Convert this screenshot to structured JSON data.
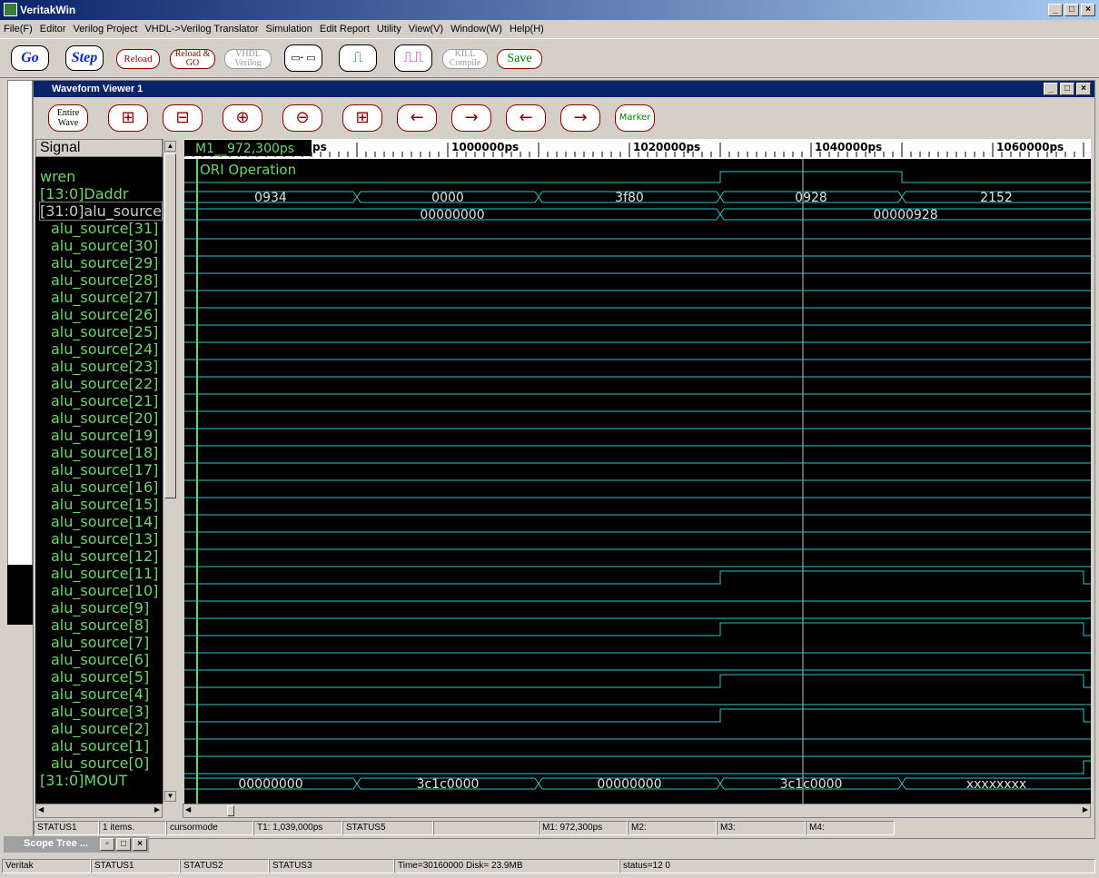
{
  "app": {
    "title": "VeritakWin"
  },
  "menu": [
    "File(F)",
    "Editor",
    "Verilog Project",
    "VHDL->Verilog Translator",
    "Simulation",
    "Edit Report",
    "Utility",
    "View(V)",
    "Window(W)",
    "Help(H)"
  ],
  "toolbar": {
    "go": "Go",
    "step": "Step",
    "reload": "Reload",
    "reload_go": "Reload & GO",
    "vhdl_verilog": "VHDL Verilog",
    "kill_compile": "KILL Compile",
    "save": "Save"
  },
  "viewer": {
    "title": "Waveform Viewer 1",
    "entire_wave": "Entire Wave",
    "marker": "Marker",
    "signal_header": "Signal",
    "marker_label": "M1__972,300ps",
    "ruler": [
      "1000000ps",
      "1020000ps",
      "1040000ps",
      "1060000ps"
    ],
    "annotation": "ORI Operation"
  },
  "signals": [
    "wren",
    "[13:0]Daddr",
    "[31:0]alu_source",
    "alu_source[31]",
    "alu_source[30]",
    "alu_source[29]",
    "alu_source[28]",
    "alu_source[27]",
    "alu_source[26]",
    "alu_source[25]",
    "alu_source[24]",
    "alu_source[23]",
    "alu_source[22]",
    "alu_source[21]",
    "alu_source[20]",
    "alu_source[19]",
    "alu_source[18]",
    "alu_source[17]",
    "alu_source[16]",
    "alu_source[15]",
    "alu_source[14]",
    "alu_source[13]",
    "alu_source[12]",
    "alu_source[11]",
    "alu_source[10]",
    "alu_source[9]",
    "alu_source[8]",
    "alu_source[7]",
    "alu_source[6]",
    "alu_source[5]",
    "alu_source[4]",
    "alu_source[3]",
    "alu_source[2]",
    "alu_source[1]",
    "alu_source[0]",
    "[31:0]MOUT"
  ],
  "bus_values": {
    "daddr": [
      "0934",
      "0000",
      "3f80",
      "0928",
      "2152"
    ],
    "alu_source": [
      "00000000",
      "00000928"
    ],
    "mout": [
      "00000000",
      "3c1c0000",
      "00000000",
      "3c1c0000",
      "xxxxxxxx"
    ]
  },
  "status_bar": {
    "s1": "STATUS1",
    "items": "1 items.",
    "mode": "cursormode",
    "t1": "T1: 1,039,000ps",
    "s5": "STATUS5",
    "m1": "M1: 972,300ps",
    "m2": "M2:",
    "m3": "M3:",
    "m4": "M4:"
  },
  "scope_tree": "Scope Tree ...",
  "app_status": {
    "a": "Veritak",
    "b": "STATUS1",
    "c": "STATUS2",
    "d": "STATUS3",
    "e": "Time=30160000 Disk= 23.9MB",
    "f": "status=12 0"
  },
  "colors": {
    "signal_text": "#6fd36f",
    "wave": "#2fc8c8",
    "background": "#000000"
  }
}
